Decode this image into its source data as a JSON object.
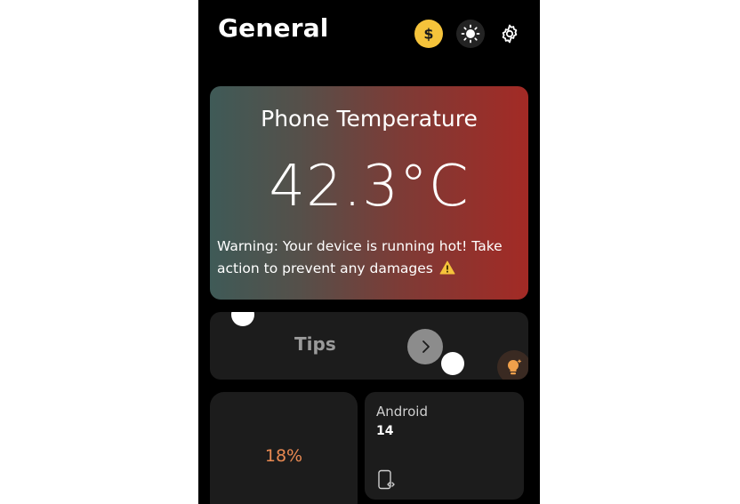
{
  "header": {
    "title": "General",
    "icons": [
      "dollar-icon",
      "sun-icon",
      "gear-icon"
    ],
    "coin_color": "#f5c33b"
  },
  "temperature": {
    "title": "Phone Temperature",
    "value": "42.3°C",
    "warning": "Warning: Your device is running hot! Take action to prevent any damages",
    "warning_icon": "warning-icon",
    "gradient": [
      "#3f5a57",
      "#a32a25"
    ]
  },
  "tips": {
    "label": "Tips",
    "arrow_icon": "chevron-right-icon",
    "badge_icon": "lightbulb-icon"
  },
  "battery": {
    "value": "18%",
    "accent": "#e98a52"
  },
  "android": {
    "label": "Android",
    "version": "14",
    "icon": "phone-code-icon"
  }
}
